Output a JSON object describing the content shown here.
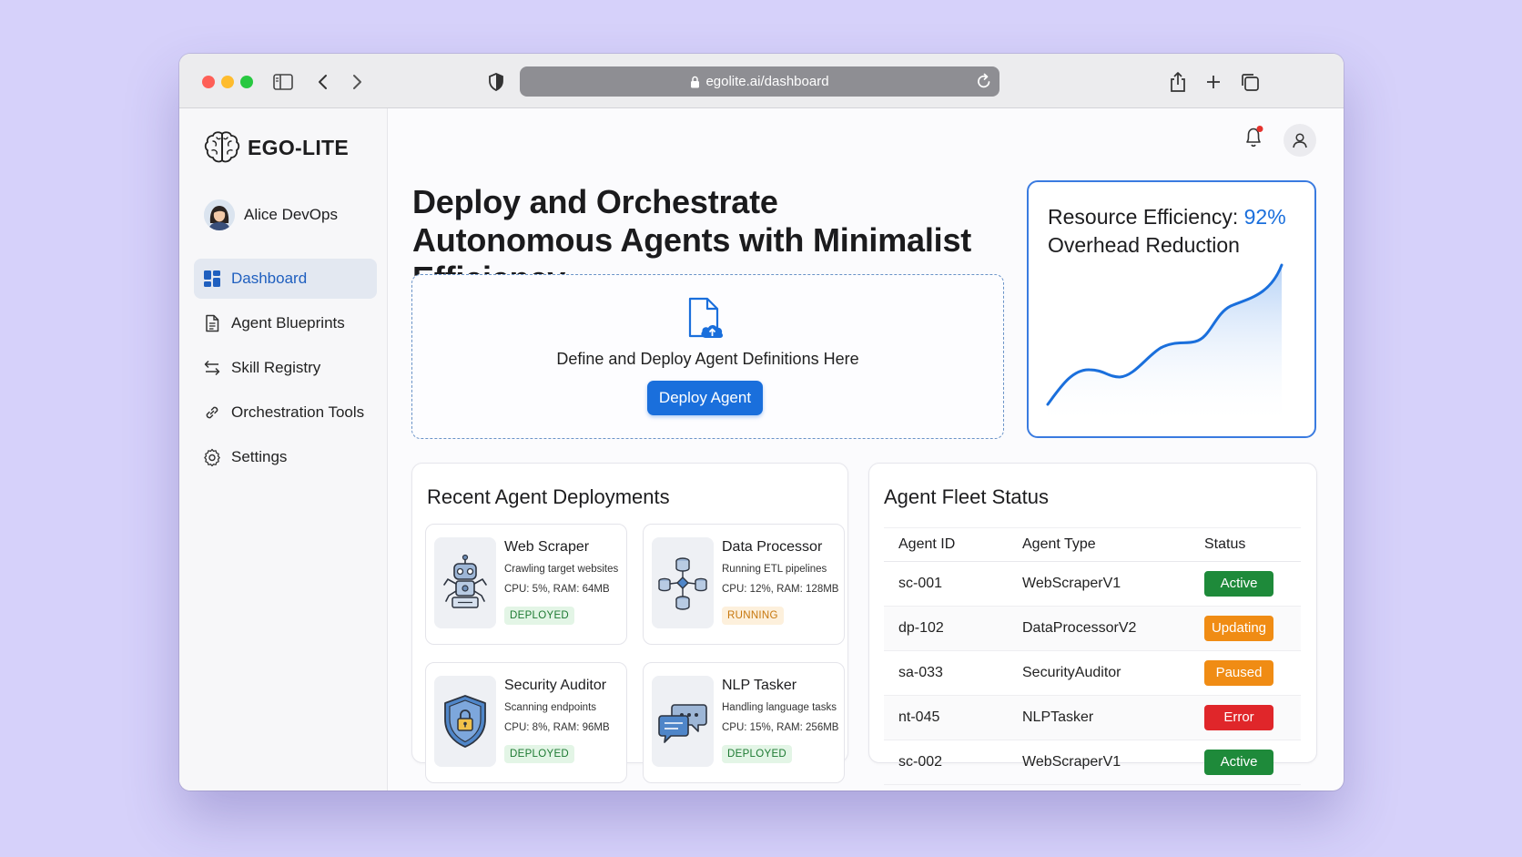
{
  "browser": {
    "url": "egolite.ai/dashboard"
  },
  "sidebar": {
    "brand": "EGO-LITE",
    "user": "Alice DevOps",
    "items": [
      {
        "label": "Dashboard",
        "icon": "dashboard-grid-icon",
        "active": true
      },
      {
        "label": "Agent Blueprints",
        "icon": "document-icon",
        "active": false
      },
      {
        "label": "Skill Registry",
        "icon": "swap-arrows-icon",
        "active": false
      },
      {
        "label": "Orchestration Tools",
        "icon": "link-icon",
        "active": false
      },
      {
        "label": "Settings",
        "icon": "gear-icon",
        "active": false
      }
    ]
  },
  "header": {
    "hero_title": "Deploy and Orchestrate Autonomous Agents with Minimalist Efficiency"
  },
  "dropzone": {
    "text": "Define and Deploy Agent Definitions Here",
    "button": "Deploy Agent"
  },
  "metric": {
    "label": "Resource Efficiency: ",
    "value": "92%",
    "subtitle": "Overhead Reduction"
  },
  "deployments": {
    "title": "Recent Agent Deployments",
    "cards": [
      {
        "name": "Web Scraper",
        "desc": "Crawling target websites",
        "resources": "CPU: 5%, RAM: 64MB",
        "status": "DEPLOYED",
        "icon": "robot-icon"
      },
      {
        "name": "Data Processor",
        "desc": "Running ETL pipelines",
        "resources": "CPU: 12%, RAM: 128MB",
        "status": "RUNNING",
        "icon": "database-network-icon"
      },
      {
        "name": "Security Auditor",
        "desc": "Scanning endpoints",
        "resources": "CPU: 8%, RAM: 96MB",
        "status": "DEPLOYED",
        "icon": "shield-lock-icon"
      },
      {
        "name": "NLP Tasker",
        "desc": "Handling language tasks",
        "resources": "CPU: 15%, RAM: 256MB",
        "status": "DEPLOYED",
        "icon": "chat-bubbles-icon"
      }
    ]
  },
  "fleet": {
    "title": "Agent Fleet Status",
    "columns": [
      "Agent ID",
      "Agent Type",
      "Status"
    ],
    "rows": [
      {
        "id": "sc-001",
        "type": "WebScraperV1",
        "status": "Active",
        "color": "#1e8a3a"
      },
      {
        "id": "dp-102",
        "type": "DataProcessorV2",
        "status": "Updating",
        "color": "#f08c14"
      },
      {
        "id": "sa-033",
        "type": "SecurityAuditor",
        "status": "Paused",
        "color": "#f08c14"
      },
      {
        "id": "nt-045",
        "type": "NLPTasker",
        "status": "Error",
        "color": "#e0262a"
      },
      {
        "id": "sc-002",
        "type": "WebScraperV1",
        "status": "Active",
        "color": "#1e8a3a"
      }
    ]
  },
  "colors": {
    "accent": "#1a6fdc",
    "active_nav_bg": "#e3e8f1"
  }
}
